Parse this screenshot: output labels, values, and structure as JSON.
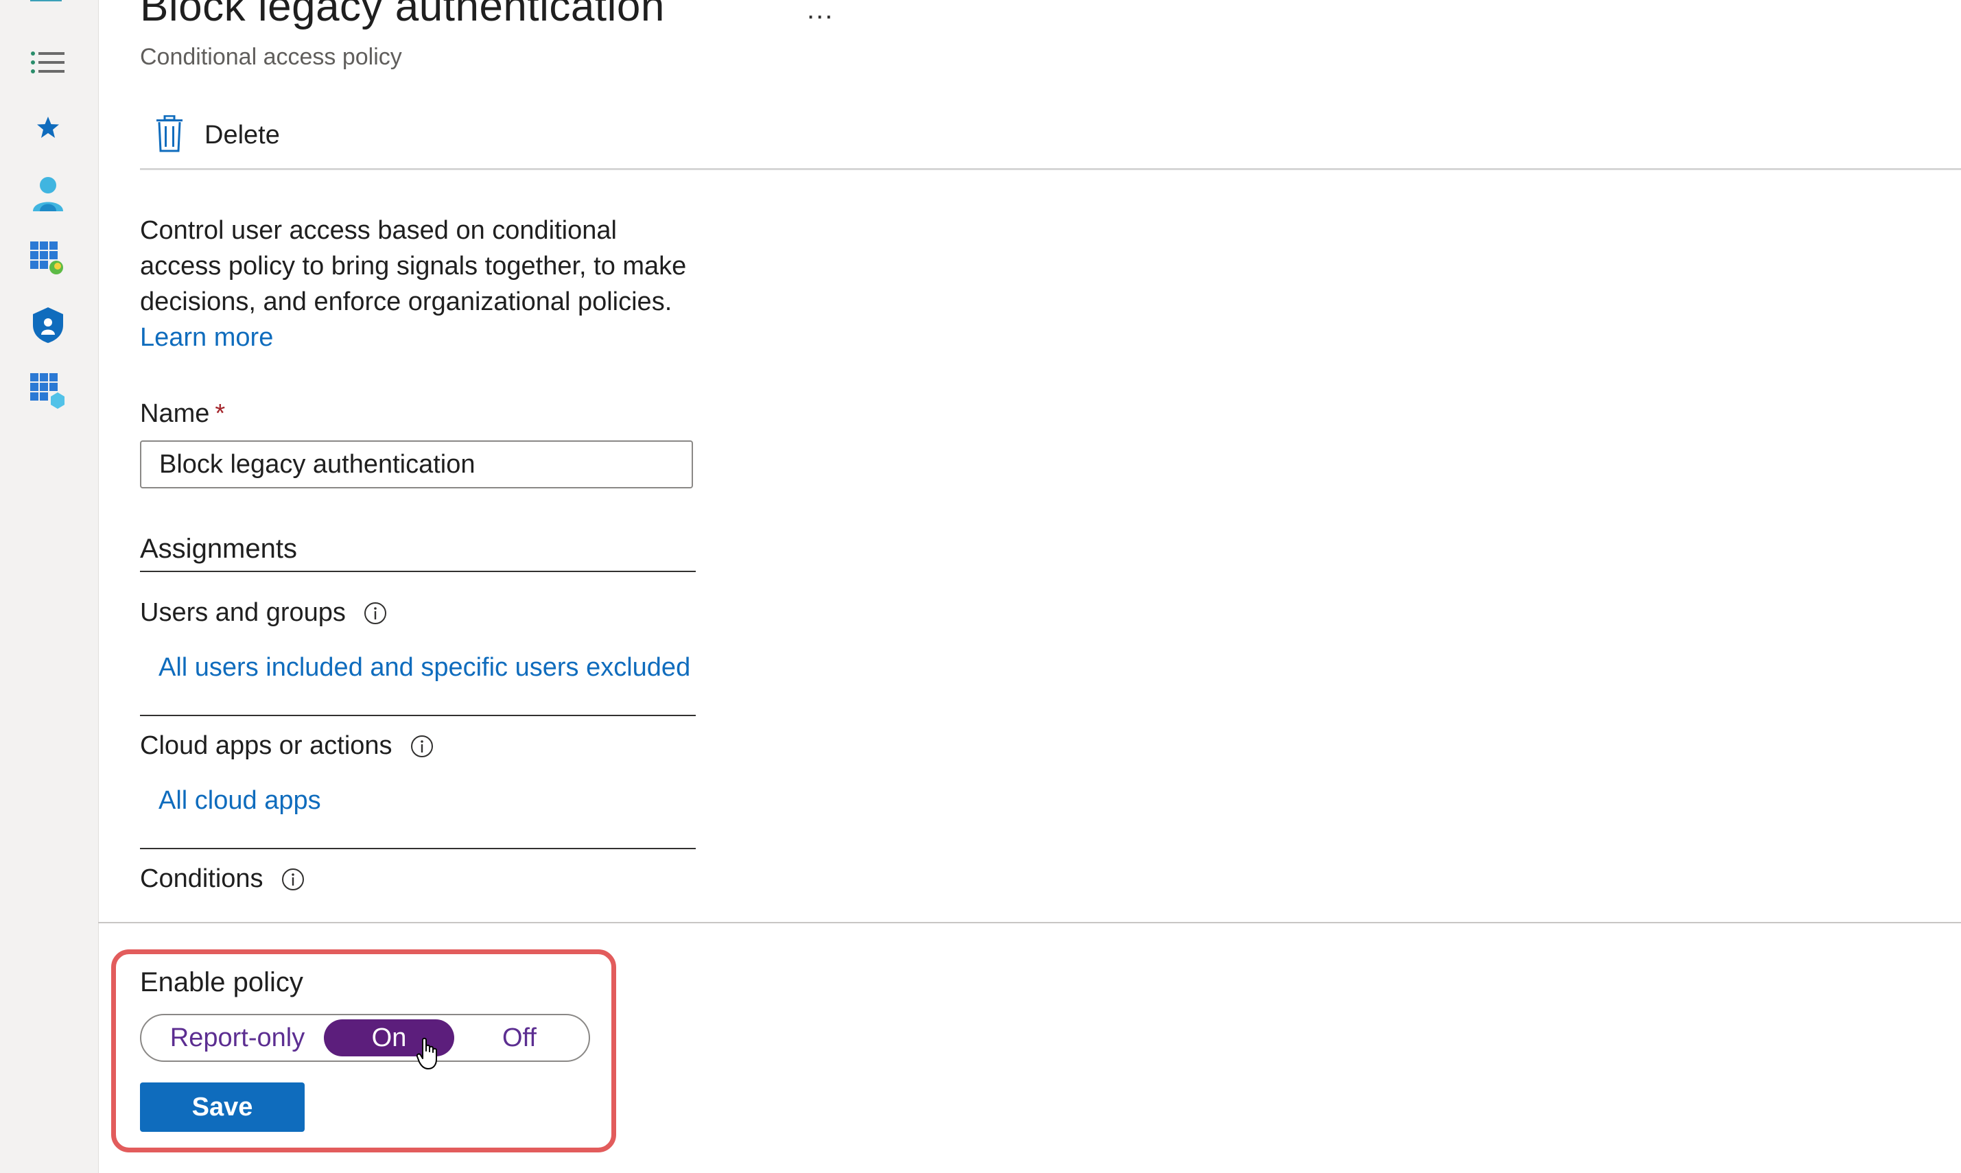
{
  "nav_rail": {
    "icons": [
      "dashboard-icon",
      "list-icon",
      "favorites-star-icon",
      "user-icon",
      "apps-icon",
      "security-lock-icon",
      "resources-icon"
    ]
  },
  "header": {
    "title": "Block legacy authentication",
    "more_label": "...",
    "subtitle": "Conditional access policy"
  },
  "toolbar": {
    "delete_label": "Delete"
  },
  "description": {
    "text": "Control user access based on conditional access policy to bring signals together, to make decisions, and enforce organizational policies.",
    "learn_more": "Learn more"
  },
  "name_field": {
    "label": "Name",
    "required_mark": "*",
    "value": "Block legacy authentication"
  },
  "assignments": {
    "heading": "Assignments",
    "users_label": "Users and groups",
    "users_value": "All users included and specific users excluded",
    "apps_label": "Cloud apps or actions",
    "apps_value": "All cloud apps",
    "conditions_label": "Conditions"
  },
  "enable_policy": {
    "label": "Enable policy",
    "options": [
      "Report-only",
      "On",
      "Off"
    ],
    "selected": "On"
  },
  "save_label": "Save",
  "colors": {
    "accent_blue": "#0f6cbd",
    "toggle_selected": "#5c1e7c",
    "highlight": "#e25c5c",
    "required": "#a4262c"
  }
}
